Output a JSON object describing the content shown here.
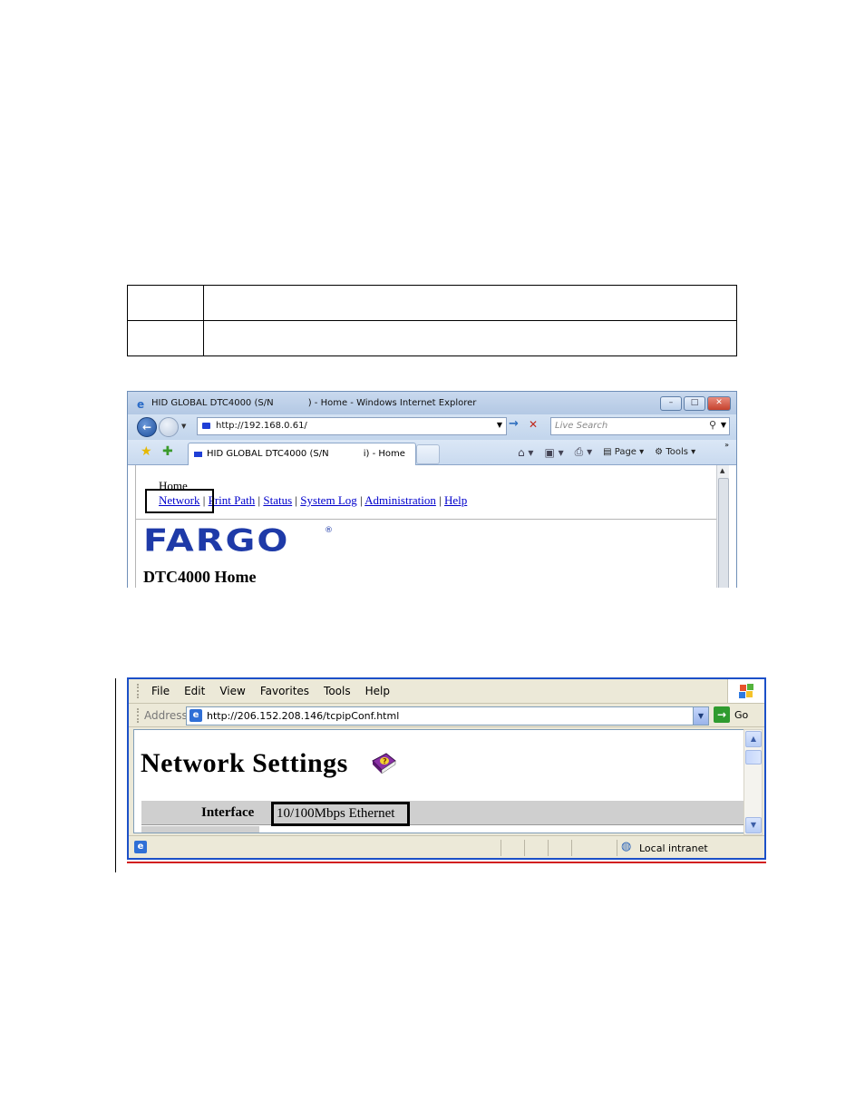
{
  "screenshot1": {
    "window_title": "HID GLOBAL DTC4000 (S/N            ) - Home - Windows Internet Explorer",
    "address_url": "http://192.168.0.61/",
    "search_placeholder": "Live Search",
    "tab_title": "HID GLOBAL DTC4000 (S/N            i) - Home",
    "command_bar": {
      "page_label": "Page",
      "tools_label": "Tools"
    },
    "page": {
      "home_label": "Home",
      "nav_links": [
        "Network",
        "Print Path",
        "Status",
        "System Log",
        "Administration",
        "Help"
      ],
      "nav_separator": "|",
      "logo_text": "FARGO",
      "logo_reg": "®",
      "heading": "DTC4000 Home"
    },
    "highlighted_link": "Network"
  },
  "screenshot2": {
    "menu_items": [
      "File",
      "Edit",
      "View",
      "Favorites",
      "Tools",
      "Help"
    ],
    "address_label": "Address",
    "address_url": "http://206.152.208.146/tcpipConf.html",
    "go_label": "Go",
    "page": {
      "heading": "Network Settings",
      "interface_label": "Interface",
      "interface_value": "10/100Mbps Ethernet"
    },
    "status_zone": "Local intranet"
  },
  "colors": {
    "fargo_blue": "#1e3aa8",
    "link_blue": "#0000cc",
    "xp_frame_blue": "#1c50c8",
    "rule_red": "#d21f1f"
  },
  "icons": [
    "ie-icon",
    "back-icon",
    "forward-icon",
    "refresh-go-icon",
    "stop-icon",
    "search-icon",
    "favorites-star-icon",
    "add-favorites-icon",
    "home-icon",
    "feeds-icon",
    "print-icon",
    "page-icon",
    "tools-gear-icon",
    "windows-logo-icon",
    "go-arrow-icon",
    "help-book-icon",
    "intranet-globe-icon"
  ]
}
